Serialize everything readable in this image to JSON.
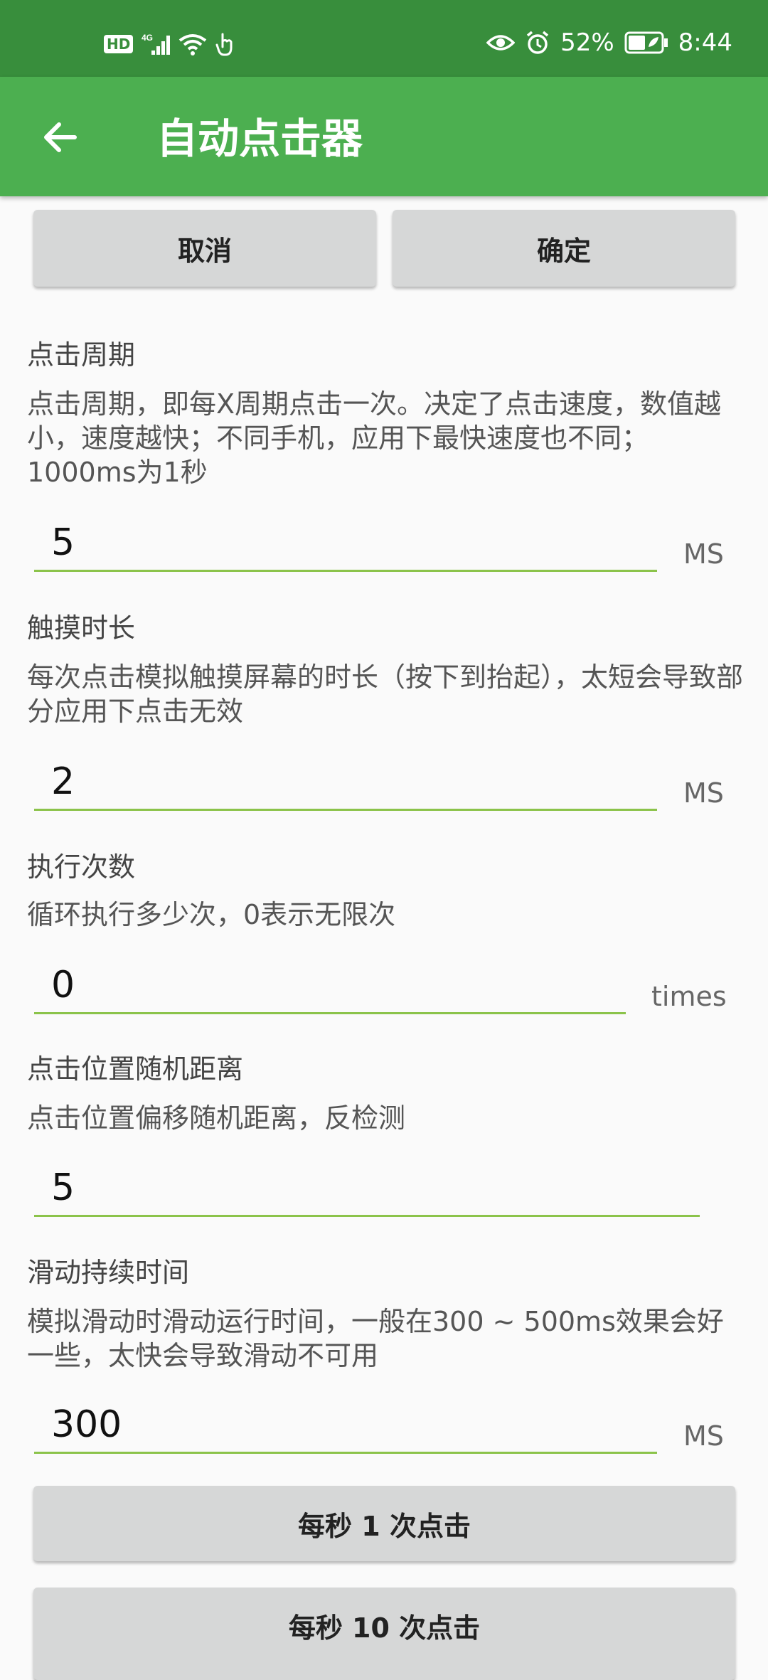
{
  "status_bar": {
    "hd": "HD",
    "network": "4G",
    "battery_pct": "52%",
    "time": "8:44",
    "icons": [
      "hd-icon",
      "signal-icon",
      "wifi-icon",
      "touch-icon",
      "eye-icon",
      "alarm-icon",
      "battery-icon"
    ]
  },
  "app_bar": {
    "title": "自动点击器",
    "back_icon": "back-arrow-icon"
  },
  "actions": {
    "cancel": "取消",
    "confirm": "确定"
  },
  "sections": [
    {
      "title": "点击周期",
      "desc": "点击周期，即每X周期点击一次。决定了点击速度，数值越小，速度越快；不同手机，应用下最快速度也不同；1000ms为1秒",
      "value": "5",
      "unit": "MS"
    },
    {
      "title": "触摸时长",
      "desc": "每次点击模拟触摸屏幕的时长（按下到抬起），太短会导致部分应用下点击无效",
      "value": "2",
      "unit": "MS"
    },
    {
      "title": "执行次数",
      "desc": "循环执行多少次，0表示无限次",
      "value": "0",
      "unit": "times"
    },
    {
      "title": "点击位置随机距离",
      "desc": "点击位置偏移随机距离，反检测",
      "value": "5",
      "unit": ""
    },
    {
      "title": "滑动持续时间",
      "desc": "模拟滑动时滑动运行时间，一般在300 ~ 500ms效果会好一些，太快会导致滑动不可用",
      "value": "300",
      "unit": "MS"
    }
  ],
  "presets": {
    "one_per_sec": "每秒 1 次点击",
    "ten_per_sec": "每秒 10 次点击"
  },
  "colors": {
    "status_bar": "#388e3c",
    "app_bar": "#4caf50",
    "accent_line": "#8bc34a",
    "button": "#d6d7d7"
  }
}
